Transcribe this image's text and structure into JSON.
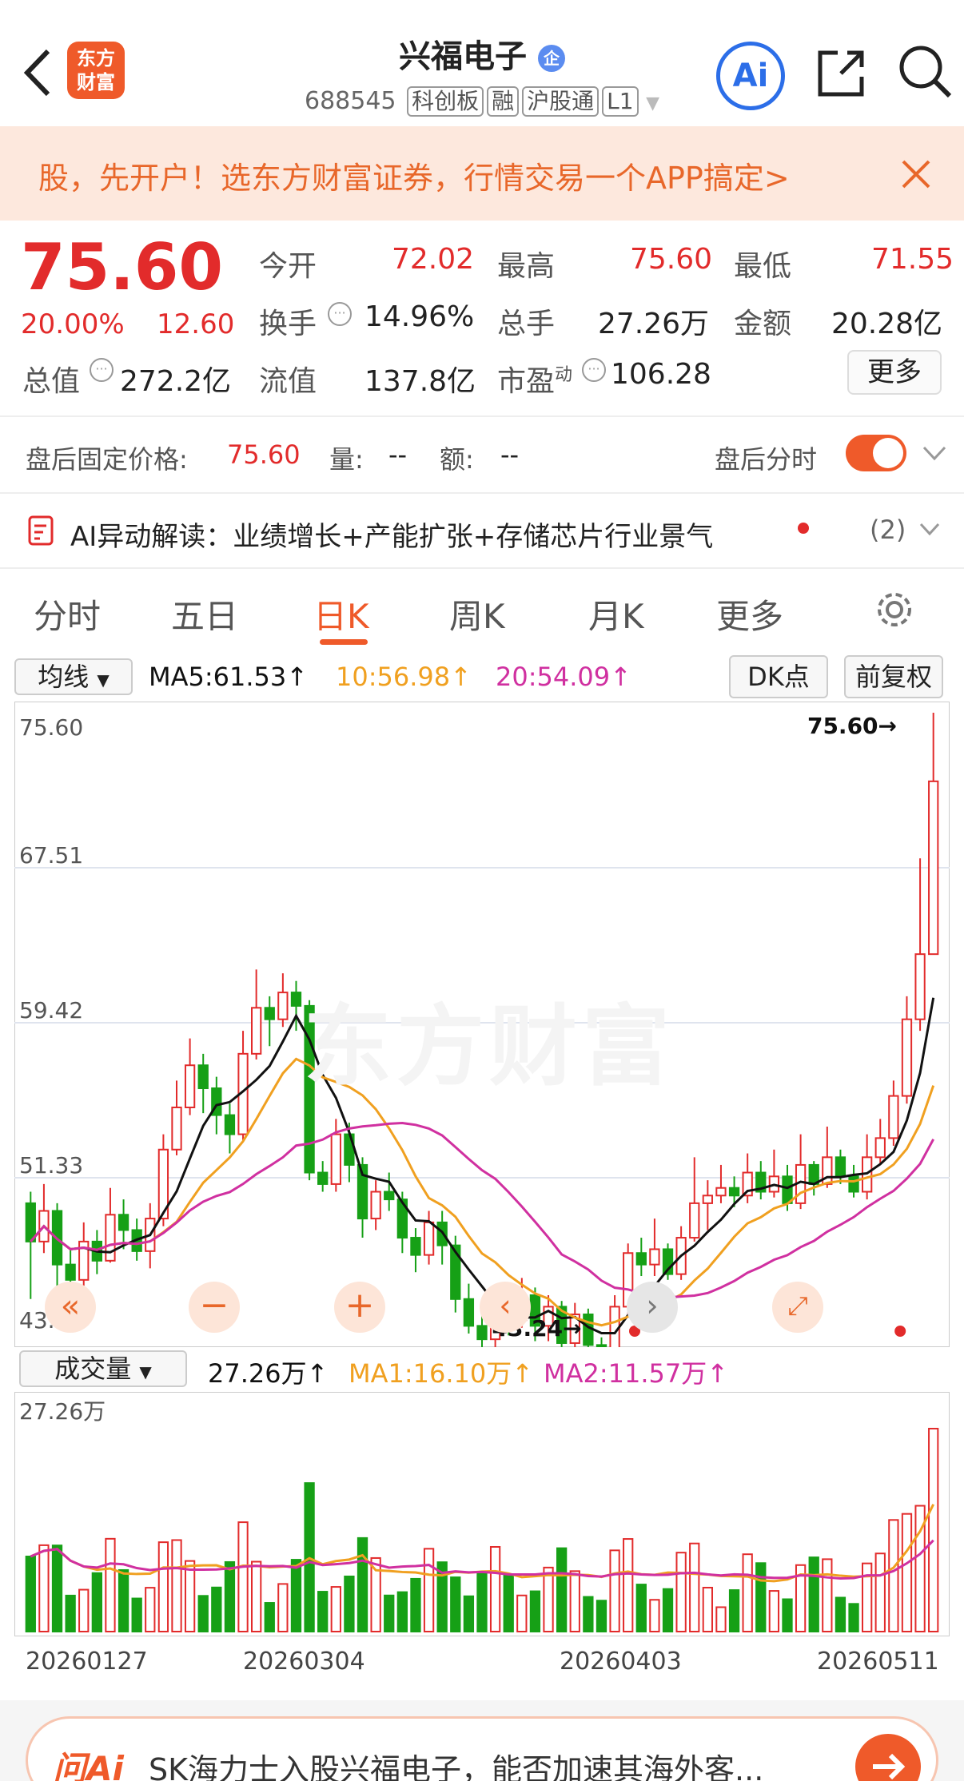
{
  "header": {
    "back_icon": "chevron-left-icon",
    "logo_text": "东方\n财富",
    "title": "兴福电子",
    "title_badge": "企",
    "code": "688545",
    "tags": [
      "科创板",
      "融",
      "沪股通",
      "L1"
    ],
    "ai_label": "Ai"
  },
  "banner": {
    "text": "股，先开户！选东方财富证券，行情交易一个APP搞定>"
  },
  "quote": {
    "price": "75.60",
    "pct": "20.00%",
    "change": "12.60",
    "open_label": "今开",
    "open": "72.02",
    "high_label": "最高",
    "high": "75.60",
    "low_label": "最低",
    "low": "71.55",
    "turnover_label": "换手",
    "turnover": "14.96%",
    "vol_label": "总手",
    "vol": "27.26万",
    "amount_label": "金额",
    "amount": "20.28亿",
    "mcap_label": "总值",
    "mcap": "272.2亿",
    "float_label": "流值",
    "float": "137.8亿",
    "pe_label": "市盈",
    "pe_sup": "动",
    "pe": "106.28",
    "more": "更多"
  },
  "after_hours": {
    "label": "盘后固定价格:",
    "price": "75.60",
    "vol_label": "量:",
    "vol": "--",
    "amt_label": "额:",
    "amt": "--",
    "timeshare": "盘后分时"
  },
  "ai_note": {
    "text": "AI异动解读：业绩增长+产能扩张+存储芯片行业景气",
    "count": "(2)"
  },
  "tabs": [
    "分时",
    "五日",
    "日K",
    "周K",
    "月K",
    "更多"
  ],
  "ma_bar": {
    "select": "均线",
    "ma5": "MA5:61.53↑",
    "ma10": "10:56.98↑",
    "ma20": "20:54.09↑",
    "dk": "DK点",
    "fq": "前复权"
  },
  "price_axis": [
    "75.60",
    "67.51",
    "59.42",
    "51.33",
    "43.24"
  ],
  "price_annot": {
    "high": "75.60→",
    "low": "43.24→"
  },
  "vol_bar": {
    "select": "成交量",
    "vol": "27.26万↑",
    "ma1": "MA1:16.10万↑",
    "ma2": "MA2:11.57万↑",
    "axis_top": "27.26万"
  },
  "dates": [
    "20260127",
    "20260304",
    "20260403",
    "20260511"
  ],
  "watermark": "东方财富",
  "bottom": {
    "logo": "问Ai",
    "text": "SK海力士入股兴福电子，能否加速其海外客..."
  },
  "colors": {
    "up": "#e22b2b",
    "down": "#16a016",
    "ma5": "#111111",
    "ma10": "#f0a020",
    "ma20": "#d030a0"
  },
  "chart_data": {
    "type": "candlestick",
    "ylim": [
      43.24,
      75.6
    ],
    "candles": [
      [
        50.0,
        48.0,
        50.6,
        45.0
      ],
      [
        48.0,
        49.6,
        51.0,
        47.4
      ],
      [
        49.6,
        46.8,
        50.0,
        45.5
      ],
      [
        46.8,
        46.0,
        47.6,
        45.2
      ],
      [
        46.0,
        48.0,
        49.0,
        45.7
      ],
      [
        48.0,
        47.0,
        48.6,
        46.3
      ],
      [
        47.0,
        49.4,
        50.8,
        46.9
      ],
      [
        49.4,
        48.6,
        50.2,
        47.6
      ],
      [
        48.6,
        47.5,
        49.2,
        47.0
      ],
      [
        47.5,
        49.2,
        50.0,
        46.6
      ],
      [
        49.2,
        52.8,
        53.6,
        48.8
      ],
      [
        52.8,
        55.0,
        56.4,
        52.5
      ],
      [
        55.0,
        57.2,
        58.6,
        54.6
      ],
      [
        57.2,
        56.0,
        57.8,
        54.7
      ],
      [
        56.0,
        54.6,
        56.6,
        53.6
      ],
      [
        54.6,
        53.6,
        55.2,
        52.6
      ],
      [
        53.6,
        57.8,
        59.0,
        53.3
      ],
      [
        57.8,
        60.2,
        62.2,
        57.5
      ],
      [
        60.2,
        59.6,
        60.8,
        58.2
      ],
      [
        59.6,
        61.0,
        62.0,
        59.2
      ],
      [
        61.0,
        60.3,
        61.6,
        59.0
      ],
      [
        60.3,
        51.6,
        60.6,
        51.2
      ],
      [
        51.6,
        51.0,
        52.2,
        50.6
      ],
      [
        51.0,
        53.6,
        54.4,
        50.6
      ],
      [
        53.6,
        52.0,
        54.2,
        51.1
      ],
      [
        52.0,
        49.2,
        52.4,
        48.2
      ],
      [
        49.2,
        50.6,
        51.2,
        48.6
      ],
      [
        50.6,
        50.2,
        51.6,
        49.6
      ],
      [
        50.2,
        48.2,
        50.6,
        47.4
      ],
      [
        48.2,
        47.3,
        48.7,
        46.4
      ],
      [
        47.3,
        49.0,
        49.6,
        46.8
      ],
      [
        49.0,
        47.8,
        49.6,
        46.8
      ],
      [
        47.8,
        45.0,
        48.3,
        44.3
      ],
      [
        45.0,
        43.6,
        45.8,
        43.2
      ],
      [
        43.6,
        42.9,
        44.6,
        42.0
      ],
      [
        42.9,
        44.6,
        45.3,
        42.3
      ],
      [
        44.6,
        43.9,
        45.0,
        43.1
      ],
      [
        43.9,
        45.2,
        46.1,
        43.5
      ],
      [
        45.2,
        43.6,
        45.6,
        42.8
      ],
      [
        43.6,
        44.6,
        45.2,
        42.8
      ],
      [
        44.6,
        42.7,
        44.9,
        42.3
      ],
      [
        42.7,
        44.2,
        44.8,
        42.1
      ],
      [
        44.2,
        42.6,
        44.5,
        42.0
      ],
      [
        42.6,
        42.0,
        43.0,
        41.8
      ],
      [
        42.0,
        44.6,
        45.2,
        41.9
      ],
      [
        44.6,
        47.4,
        47.9,
        44.1
      ],
      [
        47.4,
        46.8,
        48.2,
        46.2
      ],
      [
        46.8,
        47.6,
        49.2,
        46.2
      ],
      [
        47.6,
        46.3,
        47.9,
        46.0
      ],
      [
        46.3,
        48.2,
        48.8,
        46.0
      ],
      [
        48.2,
        50.0,
        52.4,
        48.0
      ],
      [
        50.0,
        50.4,
        51.2,
        48.6
      ],
      [
        50.4,
        50.8,
        52.0,
        50.0
      ],
      [
        50.8,
        50.4,
        51.4,
        49.8
      ],
      [
        50.4,
        51.6,
        52.6,
        50.0
      ],
      [
        51.6,
        50.6,
        52.2,
        50.2
      ],
      [
        50.6,
        51.4,
        52.8,
        50.3
      ],
      [
        51.4,
        50.0,
        52.0,
        49.6
      ],
      [
        50.0,
        52.0,
        53.6,
        49.7
      ],
      [
        52.0,
        51.0,
        52.2,
        50.4
      ],
      [
        51.0,
        52.4,
        54.0,
        50.8
      ],
      [
        52.4,
        51.4,
        52.8,
        51.0
      ],
      [
        51.4,
        50.6,
        52.0,
        50.3
      ],
      [
        50.6,
        52.4,
        53.6,
        50.2
      ],
      [
        52.4,
        53.4,
        54.4,
        52.0
      ],
      [
        53.4,
        55.6,
        56.4,
        53.0
      ],
      [
        55.6,
        59.6,
        60.8,
        55.2
      ],
      [
        59.6,
        63.0,
        68.0,
        59.0
      ],
      [
        63.0,
        72.02,
        75.6,
        71.55
      ]
    ],
    "volume_max": "27.26万"
  }
}
